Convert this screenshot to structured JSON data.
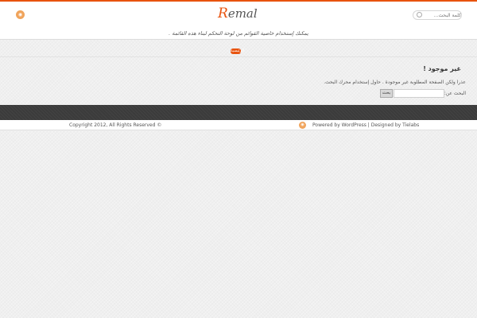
{
  "colors": {
    "accent": "#e8530e",
    "rss": "#f0a45c",
    "footer_dark": "#3b3b3b"
  },
  "header": {
    "rss_icon": "rss-icon",
    "logo_text": "Remal",
    "search_placeholder": "كلمة البحث...",
    "search_icon": "search-icon",
    "menu_hint": "يمكنك إستخدام خاصية القوائم من لوحة التحكم لبناء هذه القائمة ."
  },
  "breadcrumb": {
    "home_label": "الرئيسية"
  },
  "content": {
    "title": "غير موجود !",
    "message": "عذراً ولكن الصفحة المطلوبة غير موجودة . حاول إستخدام محرك البحث.",
    "search_label": "البحث عن:",
    "search_value": "",
    "search_button": "بحث"
  },
  "footer": {
    "copyright": "Copyright 2012, All Rights Reserved ©",
    "rss_icon": "rss-icon",
    "credits": "Powered by WordPress | Designed by Tielabs"
  }
}
